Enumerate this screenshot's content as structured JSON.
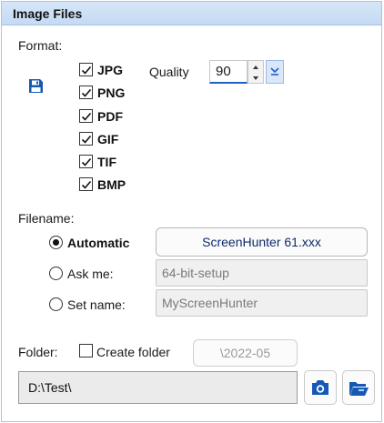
{
  "header": {
    "title": "Image Files"
  },
  "format": {
    "label": "Format:",
    "save_icon": "floppy-disk-icon",
    "types": [
      {
        "label": "JPG",
        "checked": true
      },
      {
        "label": "PNG",
        "checked": true
      },
      {
        "label": "PDF",
        "checked": true
      },
      {
        "label": "GIF",
        "checked": true
      },
      {
        "label": "TIF",
        "checked": true
      },
      {
        "label": "BMP",
        "checked": true
      }
    ],
    "quality_label": "Quality",
    "quality_value": "90"
  },
  "filename": {
    "label": "Filename:",
    "options": [
      {
        "label": "Automatic",
        "selected": true,
        "value": "ScreenHunter 61.xxx"
      },
      {
        "label": "Ask me:",
        "selected": false,
        "value": "64-bit-setup"
      },
      {
        "label": "Set name:",
        "selected": false,
        "value": "MyScreenHunter"
      }
    ]
  },
  "folder": {
    "label": "Folder:",
    "create_label": "Create folder",
    "create_checked": false,
    "subfolder": "\\2022-05",
    "path": "D:\\Test\\"
  },
  "colors": {
    "accent": "#1e62c0",
    "header_bg": "#c4daf3",
    "icon_blue": "#1559b5"
  }
}
